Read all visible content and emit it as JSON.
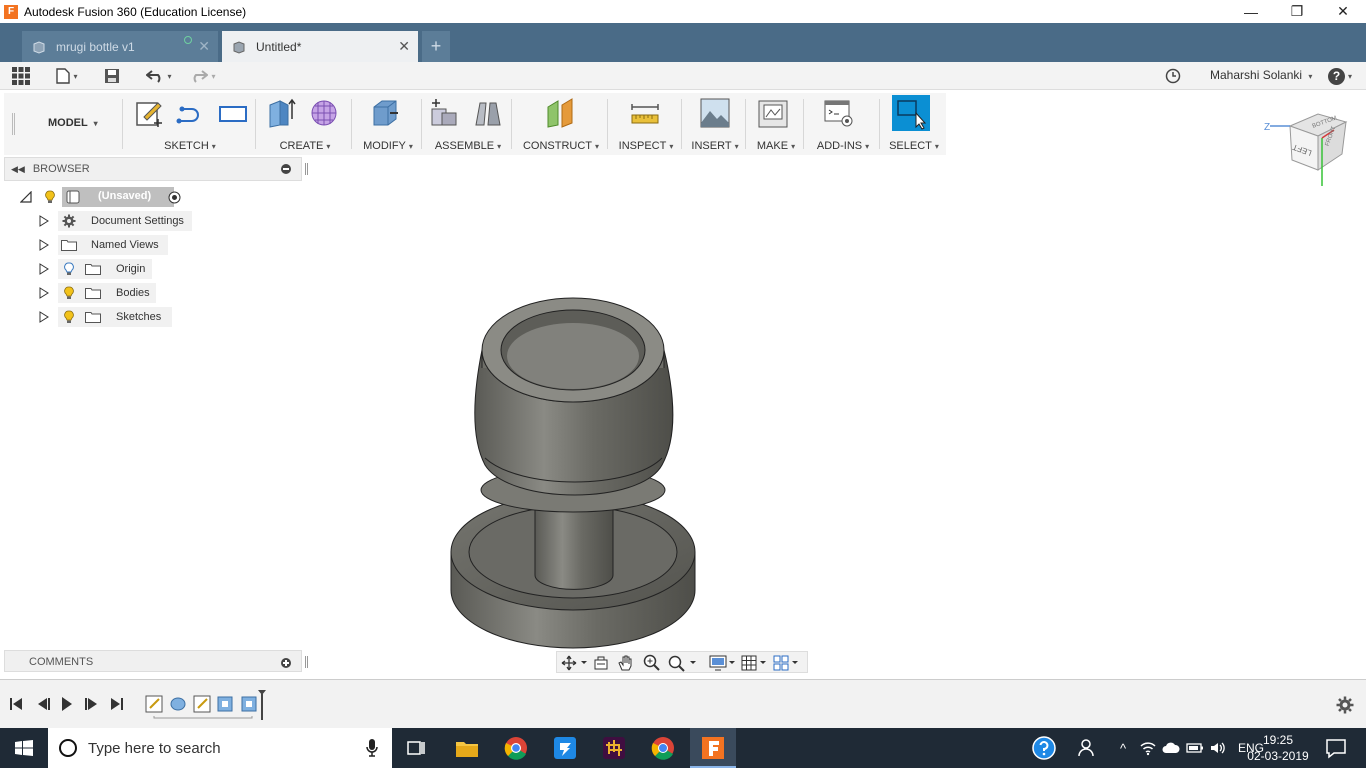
{
  "window": {
    "app_logo": "F",
    "title": "Autodesk Fusion 360 (Education License)",
    "minimize": "—",
    "maximize": "❐",
    "close": "✕"
  },
  "tabs": [
    {
      "label": "mrugi bottle v1",
      "close": "✕"
    },
    {
      "label": "Untitled*",
      "close": "✕"
    }
  ],
  "new_tab": "+",
  "user": {
    "name": "Maharshi Solanki",
    "caret": "▾"
  },
  "help": "?",
  "workspace": "MODEL",
  "ribbon": {
    "groups": [
      {
        "label": "SKETCH"
      },
      {
        "label": "CREATE"
      },
      {
        "label": "MODIFY"
      },
      {
        "label": "ASSEMBLE"
      },
      {
        "label": "CONSTRUCT"
      },
      {
        "label": "INSPECT"
      },
      {
        "label": "INSERT"
      },
      {
        "label": "MAKE"
      },
      {
        "label": "ADD-INS"
      },
      {
        "label": "SELECT"
      }
    ],
    "caret": "▾"
  },
  "browser": {
    "title": "BROWSER",
    "collapse": "◀◀",
    "root": "(Unsaved)",
    "items": [
      {
        "label": "Document Settings"
      },
      {
        "label": "Named Views"
      },
      {
        "label": "Origin"
      },
      {
        "label": "Bodies"
      },
      {
        "label": "Sketches"
      }
    ]
  },
  "comments": {
    "title": "COMMENTS"
  },
  "viewcube": {
    "face": "LEFT",
    "top_face": "FRONT",
    "side_face": "BOTTOM",
    "z_axis": "Z"
  },
  "taskbar": {
    "search_placeholder": "Type here to search",
    "language": "ENG",
    "time": "19:25",
    "date": "02-03-2019"
  },
  "colors": {
    "tabbar": "#4a6b87",
    "select_accent": "#0b8fd3",
    "taskbar": "#1f2a36",
    "fusion_orange": "#f37321"
  }
}
